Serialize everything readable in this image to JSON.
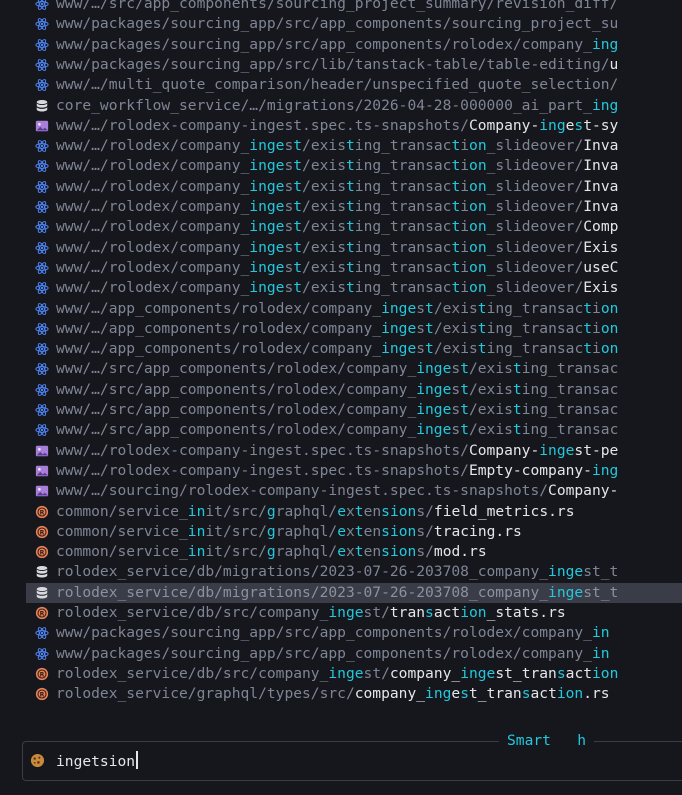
{
  "picker": {
    "query": "ingetsion",
    "mode": "Smart",
    "mode_hint": "h",
    "selected_index": 29,
    "rows": [
      {
        "icon": "react",
        "segs": [
          [
            "d",
            "www/…/src/app_components/sourcing_project_summary/revision_diff/"
          ]
        ]
      },
      {
        "icon": "react",
        "segs": [
          [
            "d",
            "www/packages/sourcing_app/src/app_components/sourcing_project_su"
          ]
        ]
      },
      {
        "icon": "react",
        "segs": [
          [
            "d",
            "www/packages/sourcing_app/src/app_components/rolodex/company_"
          ],
          [
            "m",
            "ing"
          ]
        ]
      },
      {
        "icon": "react",
        "segs": [
          [
            "d",
            "www/packages/sourcing_app/src/lib/tanstack-table/table-editing/"
          ],
          [
            "b",
            "u"
          ]
        ]
      },
      {
        "icon": "react",
        "segs": [
          [
            "d",
            "www/…/multi_quote_comparison/header/unspecified_quote_selection/"
          ]
        ]
      },
      {
        "icon": "db",
        "segs": [
          [
            "d",
            "core_workflow_service/…/migrations/2026-04-28-000000_ai_part_"
          ],
          [
            "m",
            "ing"
          ]
        ]
      },
      {
        "icon": "image",
        "segs": [
          [
            "d",
            "www/…/rolodex-company-ingest.spec.ts-snapshots/"
          ],
          [
            "b",
            "Company-"
          ],
          [
            "m",
            "ing"
          ],
          [
            "b",
            "e"
          ],
          [
            "m",
            "s"
          ],
          [
            "b",
            "t-sy"
          ]
        ]
      },
      {
        "icon": "react",
        "segs": [
          [
            "d",
            "www/…/rolodex/company_"
          ],
          [
            "m",
            "inge"
          ],
          [
            "d",
            "s"
          ],
          [
            "m",
            "t"
          ],
          [
            "d",
            "/exis"
          ],
          [
            "m",
            "t"
          ],
          [
            "d",
            "ing_transac"
          ],
          [
            "m",
            "t"
          ],
          [
            "d",
            "i"
          ],
          [
            "m",
            "on"
          ],
          [
            "d",
            "_slideover/"
          ],
          [
            "b",
            "Inva"
          ]
        ]
      },
      {
        "icon": "react",
        "segs": [
          [
            "d",
            "www/…/rolodex/company_"
          ],
          [
            "m",
            "inge"
          ],
          [
            "d",
            "s"
          ],
          [
            "m",
            "t"
          ],
          [
            "d",
            "/exis"
          ],
          [
            "m",
            "t"
          ],
          [
            "d",
            "ing_transac"
          ],
          [
            "m",
            "t"
          ],
          [
            "d",
            "i"
          ],
          [
            "m",
            "on"
          ],
          [
            "d",
            "_slideover/"
          ],
          [
            "b",
            "Inva"
          ]
        ]
      },
      {
        "icon": "react",
        "segs": [
          [
            "d",
            "www/…/rolodex/company_"
          ],
          [
            "m",
            "inge"
          ],
          [
            "d",
            "s"
          ],
          [
            "m",
            "t"
          ],
          [
            "d",
            "/exis"
          ],
          [
            "m",
            "t"
          ],
          [
            "d",
            "ing_transac"
          ],
          [
            "m",
            "t"
          ],
          [
            "d",
            "i"
          ],
          [
            "m",
            "on"
          ],
          [
            "d",
            "_slideover/"
          ],
          [
            "b",
            "Inva"
          ]
        ]
      },
      {
        "icon": "react",
        "segs": [
          [
            "d",
            "www/…/rolodex/company_"
          ],
          [
            "m",
            "inge"
          ],
          [
            "d",
            "s"
          ],
          [
            "m",
            "t"
          ],
          [
            "d",
            "/exis"
          ],
          [
            "m",
            "t"
          ],
          [
            "d",
            "ing_transac"
          ],
          [
            "m",
            "t"
          ],
          [
            "d",
            "i"
          ],
          [
            "m",
            "on"
          ],
          [
            "d",
            "_slideover/"
          ],
          [
            "b",
            "Inva"
          ]
        ]
      },
      {
        "icon": "react",
        "segs": [
          [
            "d",
            "www/…/rolodex/company_"
          ],
          [
            "m",
            "inge"
          ],
          [
            "d",
            "s"
          ],
          [
            "m",
            "t"
          ],
          [
            "d",
            "/exis"
          ],
          [
            "m",
            "t"
          ],
          [
            "d",
            "ing_transac"
          ],
          [
            "m",
            "t"
          ],
          [
            "d",
            "i"
          ],
          [
            "m",
            "on"
          ],
          [
            "d",
            "_slideover/"
          ],
          [
            "b",
            "Comp"
          ]
        ]
      },
      {
        "icon": "react",
        "segs": [
          [
            "d",
            "www/…/rolodex/company_"
          ],
          [
            "m",
            "inge"
          ],
          [
            "d",
            "s"
          ],
          [
            "m",
            "t"
          ],
          [
            "d",
            "/exis"
          ],
          [
            "m",
            "t"
          ],
          [
            "d",
            "ing_transac"
          ],
          [
            "m",
            "t"
          ],
          [
            "d",
            "i"
          ],
          [
            "m",
            "on"
          ],
          [
            "d",
            "_slideover/"
          ],
          [
            "b",
            "Exis"
          ]
        ]
      },
      {
        "icon": "react",
        "segs": [
          [
            "d",
            "www/…/rolodex/company_"
          ],
          [
            "m",
            "inge"
          ],
          [
            "d",
            "s"
          ],
          [
            "m",
            "t"
          ],
          [
            "d",
            "/exis"
          ],
          [
            "m",
            "t"
          ],
          [
            "d",
            "ing_transac"
          ],
          [
            "m",
            "t"
          ],
          [
            "d",
            "i"
          ],
          [
            "m",
            "on"
          ],
          [
            "d",
            "_slideover/"
          ],
          [
            "b",
            "useC"
          ]
        ]
      },
      {
        "icon": "react",
        "segs": [
          [
            "d",
            "www/…/rolodex/company_"
          ],
          [
            "m",
            "inge"
          ],
          [
            "d",
            "s"
          ],
          [
            "m",
            "t"
          ],
          [
            "d",
            "/exis"
          ],
          [
            "m",
            "t"
          ],
          [
            "d",
            "ing_transac"
          ],
          [
            "m",
            "t"
          ],
          [
            "d",
            "i"
          ],
          [
            "m",
            "on"
          ],
          [
            "d",
            "_slideover/"
          ],
          [
            "b",
            "Exis"
          ]
        ]
      },
      {
        "icon": "react",
        "segs": [
          [
            "d",
            "www/…/app_components/rolodex/company_"
          ],
          [
            "m",
            "inge"
          ],
          [
            "d",
            "s"
          ],
          [
            "m",
            "t"
          ],
          [
            "d",
            "/exis"
          ],
          [
            "m",
            "t"
          ],
          [
            "d",
            "ing_transac"
          ],
          [
            "m",
            "t"
          ],
          [
            "d",
            "i"
          ],
          [
            "m",
            "on"
          ]
        ]
      },
      {
        "icon": "react",
        "segs": [
          [
            "d",
            "www/…/app_components/rolodex/company_"
          ],
          [
            "m",
            "inge"
          ],
          [
            "d",
            "s"
          ],
          [
            "m",
            "t"
          ],
          [
            "d",
            "/exis"
          ],
          [
            "m",
            "t"
          ],
          [
            "d",
            "ing_transac"
          ],
          [
            "m",
            "t"
          ],
          [
            "d",
            "i"
          ],
          [
            "m",
            "on"
          ]
        ]
      },
      {
        "icon": "react",
        "segs": [
          [
            "d",
            "www/…/app_components/rolodex/company_"
          ],
          [
            "m",
            "inge"
          ],
          [
            "d",
            "s"
          ],
          [
            "m",
            "t"
          ],
          [
            "d",
            "/exis"
          ],
          [
            "m",
            "t"
          ],
          [
            "d",
            "ing_transac"
          ],
          [
            "m",
            "t"
          ],
          [
            "d",
            "i"
          ],
          [
            "m",
            "on"
          ]
        ]
      },
      {
        "icon": "react",
        "segs": [
          [
            "d",
            "www/…/src/app_components/rolodex/company_"
          ],
          [
            "m",
            "inge"
          ],
          [
            "d",
            "s"
          ],
          [
            "m",
            "t"
          ],
          [
            "d",
            "/exis"
          ],
          [
            "m",
            "t"
          ],
          [
            "d",
            "ing_transac"
          ]
        ]
      },
      {
        "icon": "react",
        "segs": [
          [
            "d",
            "www/…/src/app_components/rolodex/company_"
          ],
          [
            "m",
            "inge"
          ],
          [
            "d",
            "s"
          ],
          [
            "m",
            "t"
          ],
          [
            "d",
            "/exis"
          ],
          [
            "m",
            "t"
          ],
          [
            "d",
            "ing_transac"
          ]
        ]
      },
      {
        "icon": "react",
        "segs": [
          [
            "d",
            "www/…/src/app_components/rolodex/company_"
          ],
          [
            "m",
            "inge"
          ],
          [
            "d",
            "s"
          ],
          [
            "m",
            "t"
          ],
          [
            "d",
            "/exis"
          ],
          [
            "m",
            "t"
          ],
          [
            "d",
            "ing_transac"
          ]
        ]
      },
      {
        "icon": "react",
        "segs": [
          [
            "d",
            "www/…/src/app_components/rolodex/company_"
          ],
          [
            "m",
            "inge"
          ],
          [
            "d",
            "s"
          ],
          [
            "m",
            "t"
          ],
          [
            "d",
            "/exis"
          ],
          [
            "m",
            "t"
          ],
          [
            "d",
            "ing_transac"
          ]
        ]
      },
      {
        "icon": "image",
        "segs": [
          [
            "d",
            "www/…/rolodex-company-ingest.spec.ts-snapshots/"
          ],
          [
            "b",
            "Company-"
          ],
          [
            "m",
            "inge"
          ],
          [
            "b",
            "st-pe"
          ]
        ]
      },
      {
        "icon": "image",
        "segs": [
          [
            "d",
            "www/…/rolodex-company-ingest.spec.ts-snapshots/"
          ],
          [
            "b",
            "Empty-company-"
          ],
          [
            "m",
            "ing"
          ]
        ]
      },
      {
        "icon": "image",
        "segs": [
          [
            "d",
            "www/…/sourcing/rolodex-company-ingest.spec.ts-snapshots/"
          ],
          [
            "b",
            "Company-"
          ]
        ]
      },
      {
        "icon": "rust",
        "segs": [
          [
            "d",
            "common/service_"
          ],
          [
            "m",
            "in"
          ],
          [
            "d",
            "it/src/"
          ],
          [
            "m",
            "g"
          ],
          [
            "d",
            "raphql/"
          ],
          [
            "m",
            "e"
          ],
          [
            "d",
            "x"
          ],
          [
            "m",
            "t"
          ],
          [
            "d",
            "en"
          ],
          [
            "m",
            "sion"
          ],
          [
            "d",
            "s/"
          ],
          [
            "b",
            "field_metrics.rs"
          ]
        ]
      },
      {
        "icon": "rust",
        "segs": [
          [
            "d",
            "common/service_"
          ],
          [
            "m",
            "in"
          ],
          [
            "d",
            "it/src/"
          ],
          [
            "m",
            "g"
          ],
          [
            "d",
            "raphql/"
          ],
          [
            "m",
            "e"
          ],
          [
            "d",
            "x"
          ],
          [
            "m",
            "t"
          ],
          [
            "d",
            "en"
          ],
          [
            "m",
            "sion"
          ],
          [
            "d",
            "s/"
          ],
          [
            "b",
            "tracing.rs"
          ]
        ]
      },
      {
        "icon": "rust",
        "segs": [
          [
            "d",
            "common/service_"
          ],
          [
            "m",
            "in"
          ],
          [
            "d",
            "it/src/"
          ],
          [
            "m",
            "g"
          ],
          [
            "d",
            "raphql/"
          ],
          [
            "m",
            "e"
          ],
          [
            "d",
            "x"
          ],
          [
            "m",
            "t"
          ],
          [
            "d",
            "en"
          ],
          [
            "m",
            "sion"
          ],
          [
            "d",
            "s/"
          ],
          [
            "b",
            "mod.rs"
          ]
        ]
      },
      {
        "icon": "db",
        "segs": [
          [
            "d",
            "rolodex_service/db/migrations/2023-07-26-203708_company_"
          ],
          [
            "m",
            "inge"
          ],
          [
            "d",
            "st_t"
          ]
        ]
      },
      {
        "icon": "db",
        "segs": [
          [
            "d",
            "rolodex_service/db/migrations/2023-07-26-203708_company_"
          ],
          [
            "m",
            "inge"
          ],
          [
            "d",
            "st_t"
          ]
        ]
      },
      {
        "icon": "rust",
        "segs": [
          [
            "d",
            "rolodex_service/db/src/company_"
          ],
          [
            "m",
            "inge"
          ],
          [
            "d",
            "st/"
          ],
          [
            "b",
            "tran"
          ],
          [
            "m",
            "s"
          ],
          [
            "b",
            "act"
          ],
          [
            "m",
            "ion"
          ],
          [
            "b",
            "_stats.rs"
          ]
        ]
      },
      {
        "icon": "react",
        "segs": [
          [
            "d",
            "www/packages/sourcing_app/src/app_components/rolodex/company_"
          ],
          [
            "m",
            "in"
          ]
        ]
      },
      {
        "icon": "react",
        "segs": [
          [
            "d",
            "www/packages/sourcing_app/src/app_components/rolodex/company_"
          ],
          [
            "m",
            "in"
          ]
        ]
      },
      {
        "icon": "rust",
        "segs": [
          [
            "d",
            "rolodex_service/db/src/company_"
          ],
          [
            "m",
            "inge"
          ],
          [
            "d",
            "st/"
          ],
          [
            "b",
            "company_"
          ],
          [
            "m",
            "inge"
          ],
          [
            "b",
            "st_tran"
          ],
          [
            "m",
            "s"
          ],
          [
            "b",
            "act"
          ],
          [
            "m",
            "ion"
          ]
        ]
      },
      {
        "icon": "rust",
        "segs": [
          [
            "d",
            "rolodex_service/graphql/types/src/"
          ],
          [
            "b",
            "company_"
          ],
          [
            "m",
            "ing"
          ],
          [
            "b",
            "e"
          ],
          [
            "m",
            "s"
          ],
          [
            "b",
            "t_tran"
          ],
          [
            "m",
            "s"
          ],
          [
            "b",
            "act"
          ],
          [
            "m",
            "ion"
          ],
          [
            "b",
            ".rs"
          ]
        ]
      }
    ],
    "colors": {
      "background": "#16171d",
      "match": "#23c8dc",
      "dir": "#7e8594",
      "name": "#e4e6eb",
      "selection": "#3a3d47"
    }
  }
}
